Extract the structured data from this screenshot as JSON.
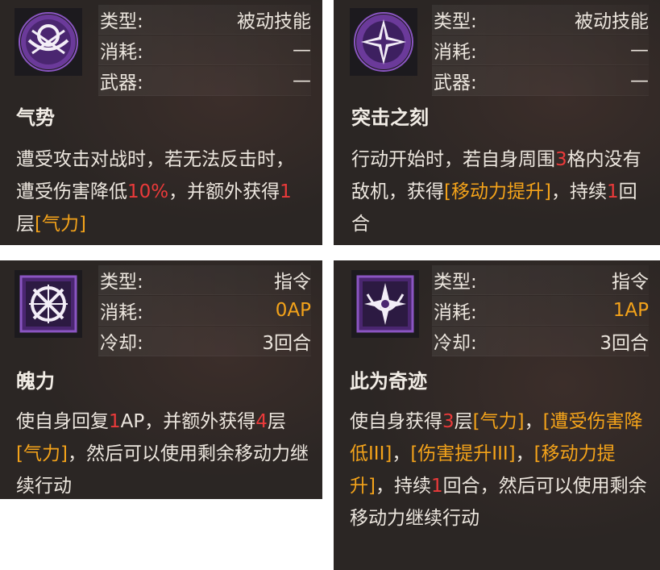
{
  "cards": [
    {
      "icon": "circle-emblem-icon",
      "stats": [
        {
          "label": "类型:",
          "value": "被动技能"
        },
        {
          "label": "消耗:",
          "value": "—"
        },
        {
          "label": "武器:",
          "value": "—"
        }
      ],
      "title": "气势",
      "desc": [
        {
          "t": "遭受攻击对战时，若无法反击时，遭受伤害降低",
          "c": ""
        },
        {
          "t": "10%",
          "c": "red"
        },
        {
          "t": "，并额外获得",
          "c": ""
        },
        {
          "t": "1",
          "c": "red"
        },
        {
          "t": "层",
          "c": ""
        },
        {
          "t": "[气力]",
          "c": "orange"
        }
      ]
    },
    {
      "icon": "shattered-star-icon",
      "stats": [
        {
          "label": "类型:",
          "value": "被动技能"
        },
        {
          "label": "消耗:",
          "value": "—"
        },
        {
          "label": "武器:",
          "value": "—"
        }
      ],
      "title": "突击之刻",
      "desc": [
        {
          "t": "行动开始时，若自身周围",
          "c": ""
        },
        {
          "t": "3",
          "c": "red"
        },
        {
          "t": "格内没有敌机，获得",
          "c": ""
        },
        {
          "t": "[移动力提升]",
          "c": "orange"
        },
        {
          "t": "，持续",
          "c": ""
        },
        {
          "t": "1",
          "c": "red"
        },
        {
          "t": "回合",
          "c": ""
        }
      ]
    },
    {
      "icon": "knot-emblem-icon",
      "stats": [
        {
          "label": "类型:",
          "value": "指令",
          "accent": false
        },
        {
          "label": "消耗:",
          "value": "0AP",
          "accent": true
        },
        {
          "label": "冷却:",
          "value": "3回合",
          "accent": false
        }
      ],
      "title": "魄力",
      "desc": [
        {
          "t": "使自身回复",
          "c": ""
        },
        {
          "t": "1",
          "c": "red"
        },
        {
          "t": "AP，并额外获得",
          "c": ""
        },
        {
          "t": "4",
          "c": "red"
        },
        {
          "t": "层",
          "c": ""
        },
        {
          "t": "[气力]",
          "c": "orange"
        },
        {
          "t": "，然后可以使用剩余移动力继续行动",
          "c": ""
        }
      ]
    },
    {
      "icon": "miracle-star-icon",
      "stats": [
        {
          "label": "类型:",
          "value": "指令",
          "accent": false
        },
        {
          "label": "消耗:",
          "value": "1AP",
          "accent": true
        },
        {
          "label": "冷却:",
          "value": "3回合",
          "accent": false
        }
      ],
      "title": "此为奇迹",
      "desc": [
        {
          "t": "使自身获得",
          "c": ""
        },
        {
          "t": "3",
          "c": "red"
        },
        {
          "t": "层",
          "c": ""
        },
        {
          "t": "[气力]",
          "c": "orange"
        },
        {
          "t": "，",
          "c": ""
        },
        {
          "t": "[遭受伤害降低III]",
          "c": "orange"
        },
        {
          "t": "，",
          "c": ""
        },
        {
          "t": "[伤害提升III]",
          "c": "orange"
        },
        {
          "t": "，",
          "c": ""
        },
        {
          "t": "[移动力提升]",
          "c": "orange"
        },
        {
          "t": "，持续",
          "c": ""
        },
        {
          "t": "1",
          "c": "red"
        },
        {
          "t": "回合，然后可以使用剩余移动力继续行动",
          "c": ""
        }
      ]
    }
  ]
}
